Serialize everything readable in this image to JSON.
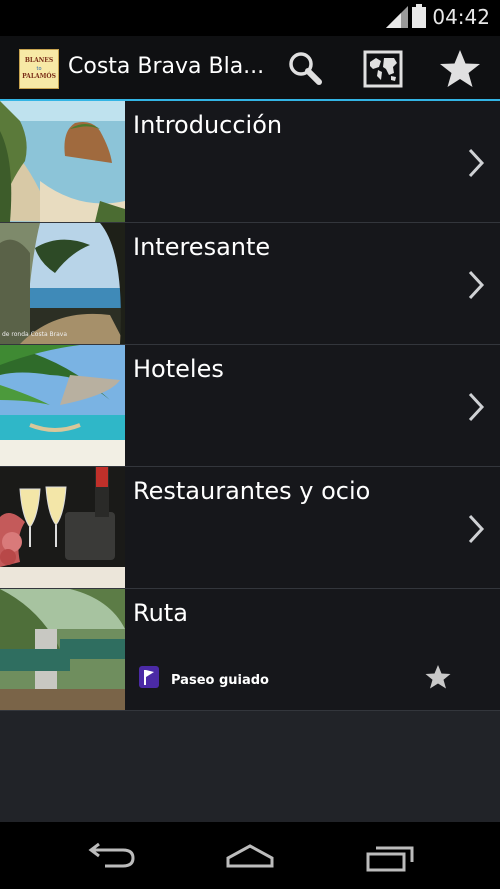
{
  "status_bar": {
    "time": "04:42"
  },
  "action_bar": {
    "logo_text": [
      "BLANES",
      "to",
      "PALAMÓS"
    ],
    "title": "Costa Brava Bla...",
    "icons": [
      "search-icon",
      "map-icon",
      "star-icon"
    ],
    "accent_color": "#33b5e5"
  },
  "list": {
    "items": [
      {
        "label": "Introducción"
      },
      {
        "label": "Interesante",
        "thumb_caption": "de ronda Costa Brava"
      },
      {
        "label": "Hoteles"
      },
      {
        "label": "Restaurantes y ocio"
      },
      {
        "label": "Ruta",
        "badge": "Paseo guiado"
      }
    ]
  }
}
